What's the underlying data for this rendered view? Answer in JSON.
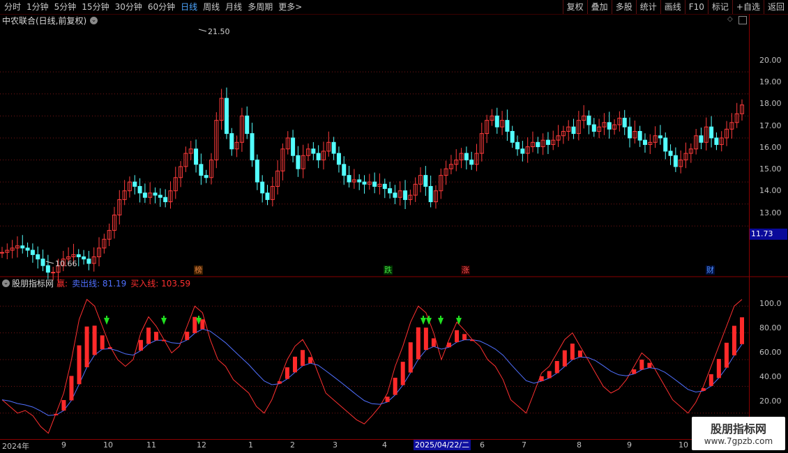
{
  "toolbar": {
    "periods": [
      "分时",
      "1分钟",
      "5分钟",
      "15分钟",
      "30分钟",
      "60分钟",
      "日线",
      "周线",
      "月线",
      "多周期",
      "更多>"
    ],
    "active_period": "日线",
    "buttons": [
      "复权",
      "叠加",
      "多股",
      "统计",
      "画线",
      "F10",
      "标记",
      "+自选",
      "返回"
    ]
  },
  "main": {
    "title": "中农联合(日线,前复权)",
    "last_price": "11.73",
    "high_label": "21.50",
    "low_label": "10.66",
    "price_ticks": [
      "20.00",
      "19.00",
      "18.00",
      "17.00",
      "16.00",
      "15.00",
      "14.00",
      "13.00"
    ],
    "events": [
      {
        "label": "榜",
        "color": "#e08040",
        "bg": "#402000"
      },
      {
        "label": "跌",
        "color": "#40e040",
        "bg": "#003000"
      },
      {
        "label": "涨",
        "color": "#ff5050",
        "bg": "#300000"
      },
      {
        "label": "财",
        "color": "#5090ff",
        "bg": "#001040"
      }
    ]
  },
  "indicator": {
    "name": "股朋指标网",
    "item1_label": "赢:",
    "item2_label": "卖出线: 81.19",
    "item3_label": "买入线: 103.59",
    "ticks": [
      "100.0",
      "80.00",
      "60.00",
      "40.00",
      "20.00"
    ],
    "colors": {
      "win": "#ff3030",
      "sell": "#5070ff",
      "buy": "#ff3030"
    }
  },
  "date_axis": {
    "labels": [
      "2024年",
      "9",
      "10",
      "11",
      "12",
      "1",
      "2",
      "3",
      "4",
      "5",
      "6",
      "7",
      "8",
      "9",
      "10"
    ],
    "selected": "2025/04/22/二"
  },
  "watermark": {
    "title": "股朋指标网",
    "url": "www.7gpzb.com"
  },
  "chart_data": {
    "type": "candlestick",
    "price_range": [
      11.3,
      22.0
    ],
    "close_series": [
      11.8,
      11.9,
      12.0,
      12.1,
      12.0,
      11.9,
      11.7,
      11.5,
      11.2,
      10.9,
      10.9,
      11.2,
      11.5,
      11.6,
      11.7,
      11.6,
      11.5,
      11.3,
      11.6,
      12.0,
      12.4,
      12.8,
      13.5,
      14.2,
      14.6,
      15.0,
      14.8,
      14.5,
      14.3,
      14.5,
      14.4,
      14.3,
      14.1,
      14.6,
      15.2,
      15.7,
      16.3,
      16.5,
      15.8,
      15.3,
      15.2,
      16.0,
      17.8,
      18.8,
      17.2,
      16.5,
      16.8,
      18.0,
      17.2,
      16.0,
      15.0,
      14.5,
      14.2,
      14.8,
      15.5,
      16.5,
      17.0,
      16.2,
      15.6,
      16.2,
      16.5,
      16.3,
      16.0,
      16.4,
      16.8,
      16.3,
      15.8,
      15.3,
      15.0,
      15.1,
      15.0,
      14.9,
      15.0,
      14.8,
      14.9,
      14.7,
      14.5,
      14.3,
      14.6,
      14.2,
      14.4,
      14.9,
      15.3,
      14.8,
      14.1,
      14.6,
      15.3,
      15.6,
      15.8,
      16.0,
      16.3,
      16.0,
      15.8,
      16.3,
      17.2,
      17.8,
      18.0,
      17.5,
      17.8,
      17.3,
      16.8,
      16.5,
      16.3,
      16.6,
      16.8,
      16.6,
      16.9,
      16.7,
      16.9,
      17.1,
      17.3,
      17.5,
      17.2,
      17.8,
      18.0,
      17.6,
      17.3,
      17.5,
      17.7,
      17.4,
      17.6,
      17.9,
      17.5,
      17.0,
      17.3,
      16.9,
      16.7,
      16.8,
      17.1,
      17.0,
      16.4,
      16.2,
      15.7,
      16.0,
      16.3,
      16.5,
      17.1,
      16.8,
      17.5,
      17.0,
      16.7,
      17.0,
      17.4,
      17.7,
      18.1,
      18.5
    ],
    "indicator_win": [
      30,
      25,
      20,
      22,
      18,
      10,
      5,
      20,
      35,
      60,
      90,
      105,
      100,
      85,
      70,
      60,
      55,
      60,
      80,
      92,
      85,
      75,
      65,
      70,
      85,
      100,
      95,
      75,
      60,
      55,
      45,
      40,
      35,
      25,
      20,
      30,
      45,
      60,
      70,
      75,
      65,
      50,
      35,
      30,
      25,
      20,
      15,
      12,
      18,
      25,
      35,
      55,
      70,
      88,
      100,
      95,
      80,
      60,
      75,
      88,
      82,
      75,
      70,
      60,
      55,
      45,
      30,
      25,
      20,
      35,
      50,
      55,
      65,
      75,
      80,
      70,
      60,
      50,
      40,
      35,
      38,
      45,
      55,
      65,
      60,
      50,
      40,
      30,
      25,
      20,
      28,
      40,
      55,
      70,
      85,
      100,
      105
    ]
  }
}
